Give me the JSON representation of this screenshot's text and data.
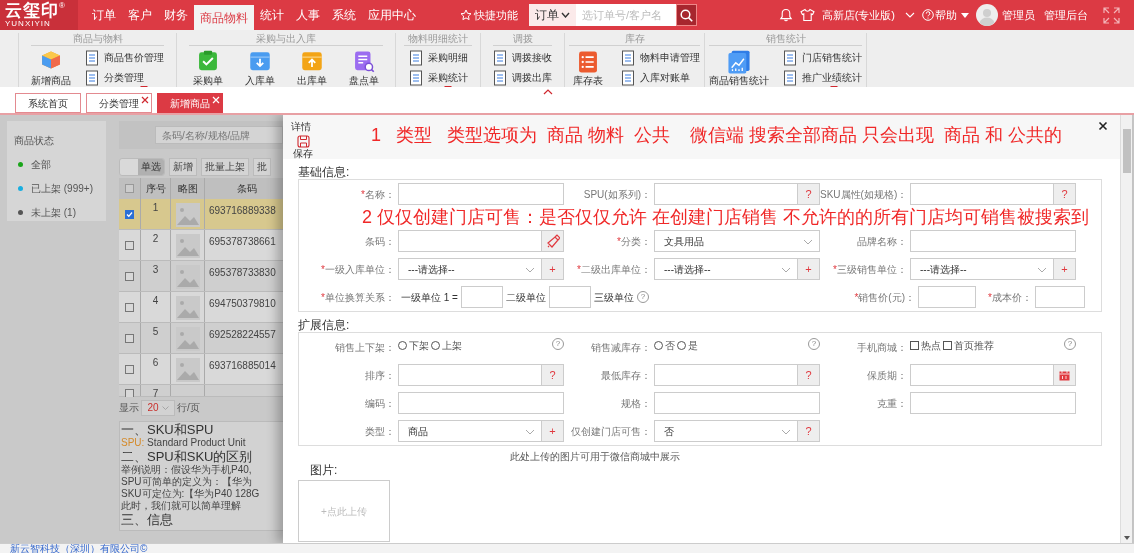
{
  "top_bar": {
    "logo": "云玺印",
    "logo_mark": "®",
    "logo_sub": "YUNXIYIN",
    "nav": [
      {
        "label": "订单",
        "selected": false
      },
      {
        "label": "客户",
        "selected": false
      },
      {
        "label": "财务",
        "selected": false
      },
      {
        "label": "商品物料",
        "selected": true
      },
      {
        "label": "统计",
        "selected": false
      },
      {
        "label": "人事",
        "selected": false
      },
      {
        "label": "系统",
        "selected": false
      },
      {
        "label": "应用中心",
        "selected": false
      }
    ],
    "quick": "快捷功能",
    "search": {
      "scope": "订单",
      "placeholder": "选订单号/客户名"
    },
    "store": "高新店(专业版)",
    "help": "帮助",
    "user": "管理员",
    "admin": "管理后台"
  },
  "ribbon": [
    {
      "title": "商品与物料",
      "more": true,
      "items": [
        {
          "kind": "big",
          "label": "新增商品"
        },
        {
          "kind": "small",
          "label": "商品售价管理"
        },
        {
          "kind": "small",
          "label": "分类管理"
        }
      ]
    },
    {
      "title": "采购与出入库",
      "more": false,
      "items": [
        {
          "kind": "big",
          "label": "采购单"
        },
        {
          "kind": "big",
          "label": "入库单"
        },
        {
          "kind": "big",
          "label": "出库单"
        },
        {
          "kind": "big",
          "label": "盘点单"
        }
      ]
    },
    {
      "title": "物料明细统计",
      "more": true,
      "items": [
        {
          "kind": "small",
          "label": "采购明细"
        },
        {
          "kind": "small",
          "label": "采购统计"
        }
      ]
    },
    {
      "title": "调拨",
      "more": false,
      "items": [
        {
          "kind": "small",
          "label": "调拨接收"
        },
        {
          "kind": "small",
          "label": "调拨出库"
        }
      ]
    },
    {
      "title": "库存",
      "more": false,
      "items": [
        {
          "kind": "big",
          "label": "库存表"
        },
        {
          "kind": "small",
          "label": "物料申请管理"
        },
        {
          "kind": "small",
          "label": "入库对账单"
        }
      ]
    },
    {
      "title": "销售统计",
      "more": true,
      "items": [
        {
          "kind": "big",
          "label": "商品销售统计"
        },
        {
          "kind": "small",
          "label": "门店销售统计"
        },
        {
          "kind": "small",
          "label": "推广业绩统计"
        }
      ]
    }
  ],
  "tabs": [
    {
      "label": "系统首页",
      "closable": false,
      "selected": false
    },
    {
      "label": "分类管理",
      "closable": true,
      "selected": false
    },
    {
      "label": "新增商品",
      "closable": true,
      "selected": true
    }
  ],
  "status_panel": {
    "title": "商品状态",
    "items": [
      {
        "label": "全部",
        "color": "#1aa51a"
      },
      {
        "label": "已上架 (999+)",
        "color": "#18aee0"
      },
      {
        "label": "未上架 (1)",
        "color": "#555555"
      }
    ]
  },
  "list": {
    "search_placeholder": "条码/名称/规格/品牌",
    "toggle": {
      "label": "单选",
      "on": true
    },
    "buttons": [
      "新增",
      "批量上架",
      "批"
    ],
    "all_checked": false,
    "columns": [
      "序号",
      "略图",
      "条码"
    ],
    "rows": [
      {
        "index": "1",
        "barcode": "693716889338",
        "checked": true
      },
      {
        "index": "2",
        "barcode": "695378738661",
        "checked": false
      },
      {
        "index": "3",
        "barcode": "695378733830",
        "checked": false
      },
      {
        "index": "4",
        "barcode": "694750379810",
        "checked": false
      },
      {
        "index": "5",
        "barcode": "692528224557",
        "checked": false
      },
      {
        "index": "6",
        "barcode": "693716885014",
        "checked": false
      },
      {
        "index": "7",
        "checked": false
      }
    ],
    "pager": {
      "prefix": "显示",
      "page_size": "20",
      "suffix": "行/页"
    }
  },
  "article": [
    {
      "kind": "heading",
      "text": "一、SKU和SPU"
    },
    {
      "kind": "term",
      "term": "SPU:",
      "text": "Standard Product Unit"
    },
    {
      "kind": "heading",
      "text": "二、SPU和SKU的区别"
    },
    {
      "kind": "line",
      "text": "举例说明：假设华为手机P40,"
    },
    {
      "kind": "line",
      "text": "SPU可简单的定义为：【华为"
    },
    {
      "kind": "line",
      "text": "SKU可定位为:【华为P40 128G"
    },
    {
      "kind": "line",
      "text": "此时，我们就可以简单理解"
    },
    {
      "kind": "heading",
      "text": "三、信息"
    }
  ],
  "modal": {
    "title": "详情",
    "save": "保存",
    "notes": [
      "1   类型   类型选项为  商品 物料  公共    微信端 搜索全部商品 只会出现  商品 和 公共的",
      "2 仅仅创建门店可售：是否仅仅允许 在创建门店销售 不允许的的所有门店均可销售被搜索到"
    ],
    "basic": {
      "title": "基础信息:",
      "rows": [
        [
          {
            "kind": "input",
            "required_mark": "*",
            "label": "名称："
          },
          {
            "kind": "input",
            "label": "SPU(如系列)：",
            "addon": "?"
          },
          {
            "kind": "input",
            "label": "SKU属性(如规格)：",
            "addon": "?"
          }
        ],
        [
          {
            "kind": "input",
            "label": "条码：",
            "tool": true
          },
          {
            "kind": "select",
            "required_mark": "*",
            "label": "分类：",
            "value": "文具用品"
          },
          {
            "kind": "input",
            "label": "品牌名称："
          }
        ],
        [
          {
            "kind": "select",
            "required_mark": "*",
            "label": "一级入库单位：",
            "value": "---请选择--",
            "addon": "+"
          },
          {
            "kind": "select",
            "required_mark": "*",
            "label": "二级出库单位：",
            "value": "---请选择--",
            "addon": "+"
          },
          {
            "kind": "select",
            "required_mark": "*",
            "label": "三级销售单位：",
            "value": "---请选择--",
            "addon": "+"
          }
        ],
        [
          {
            "kind": "units",
            "required_mark": "*",
            "label": "单位换算关系：",
            "parts": [
              "一级单位 1 =",
              "二级单位",
              "三级单位"
            ],
            "help": "?"
          },
          "",
          {
            "kind": "prices",
            "fields": [
              {
                "required_mark": "*",
                "label": "销售价(元)："
              },
              {
                "required_mark": "*",
                "label": "成本价："
              }
            ]
          }
        ]
      ]
    },
    "extended": {
      "title": "扩展信息:",
      "rows": [
        [
          {
            "kind": "radios",
            "label": "销售上下架：",
            "options": [
              {
                "label": "下架",
                "selected": false
              },
              {
                "label": "上架",
                "selected": false
              }
            ],
            "help": "?"
          },
          {
            "kind": "radios",
            "label": "销售减库存：",
            "options": [
              {
                "label": "否",
                "selected": false
              },
              {
                "label": "是",
                "selected": false
              }
            ],
            "help": "?"
          },
          {
            "kind": "checks",
            "label": "手机商城：",
            "options": [
              {
                "label": "热点",
                "checked": false
              },
              {
                "label": "首页推荐",
                "checked": false
              }
            ],
            "help": "?"
          }
        ],
        [
          {
            "kind": "input",
            "label": "排序：",
            "addon": "?"
          },
          {
            "kind": "input",
            "label": "最低库存：",
            "addon": "?"
          },
          {
            "kind": "input",
            "label": "保质期：",
            "calendar": true
          }
        ],
        [
          {
            "kind": "input",
            "label": "编码："
          },
          {
            "kind": "input",
            "label": "规格："
          },
          {
            "kind": "input",
            "label": "克重："
          }
        ],
        [
          {
            "kind": "select",
            "label": "类型：",
            "value": "商品",
            "addon": "+"
          },
          {
            "kind": "select",
            "label": "仅创建门店可售：",
            "value": "否",
            "addon": "?"
          }
        ]
      ]
    },
    "image_hint": "此处上传的图片可用于微信商城中展示",
    "image_title": "图片:",
    "upload": "+点此上传"
  },
  "footer": "新云智科技（深圳）有限公司©"
}
